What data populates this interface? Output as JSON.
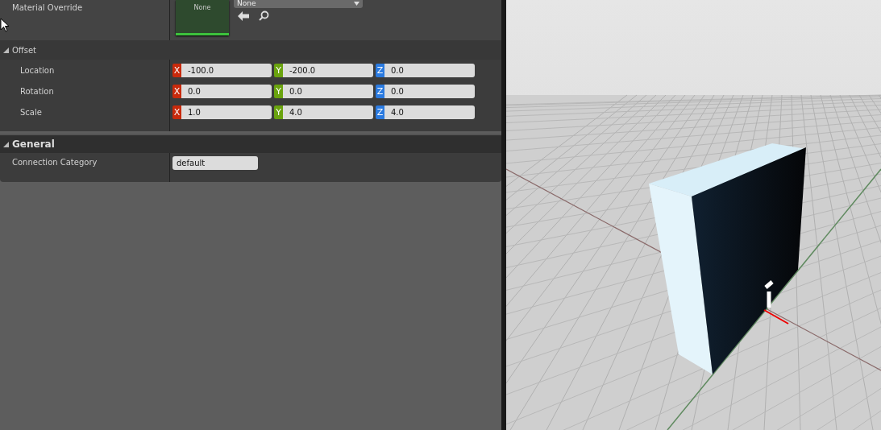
{
  "material_override": {
    "label": "Material Override",
    "thumbnail_label": "None",
    "dropdown_value": "None"
  },
  "sections": [
    {
      "title": "Offset",
      "expanded": true,
      "kind": "sub",
      "rows": [
        {
          "label": "Location",
          "fields": [
            {
              "axis": "X",
              "color": "#c82a0c",
              "value": "-100.0"
            },
            {
              "axis": "Y",
              "color": "#6aa30e",
              "value": "-200.0"
            },
            {
              "axis": "Z",
              "color": "#2a7ae0",
              "value": "0.0"
            }
          ]
        },
        {
          "label": "Rotation",
          "fields": [
            {
              "axis": "X",
              "color": "#c82a0c",
              "value": "0.0"
            },
            {
              "axis": "Y",
              "color": "#6aa30e",
              "value": "0.0"
            },
            {
              "axis": "Z",
              "color": "#2a7ae0",
              "value": "0.0"
            }
          ]
        },
        {
          "label": "Scale",
          "fields": [
            {
              "axis": "X",
              "color": "#c82a0c",
              "value": "1.0"
            },
            {
              "axis": "Y",
              "color": "#6aa30e",
              "value": "4.0"
            },
            {
              "axis": "Z",
              "color": "#2a7ae0",
              "value": "4.0"
            }
          ]
        }
      ]
    },
    {
      "title": "General",
      "expanded": true,
      "kind": "category",
      "rows": [
        {
          "label": "Connection Category",
          "value": "default"
        }
      ]
    }
  ]
}
